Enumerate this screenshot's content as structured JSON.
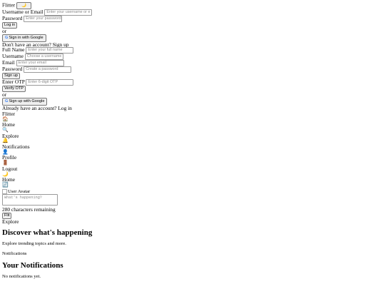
{
  "login": {
    "brand": "Flitter",
    "theme_icon": "🌙",
    "username_label": "Username or Email",
    "username_placeholder": "Enter your username or e",
    "password_label": "Password",
    "password_placeholder": "Enter your password",
    "login_button": "Log in",
    "or_text": "or",
    "google_button": "Sign in with Google",
    "signup_prompt": "Don't have an account? Sign up"
  },
  "signup": {
    "fullname_label": "Full Name",
    "fullname_placeholder": "Enter your full name",
    "username_label": "Username",
    "username_placeholder": "Choose a username",
    "email_label": "Email",
    "email_placeholder": "Enter your email",
    "password_label": "Password",
    "password_placeholder": "Create a password",
    "signup_button": "Sign up",
    "otp_label": "Enter OTP",
    "otp_placeholder": "Enter 6-digit OTP",
    "verify_button": "Verify OTP",
    "or_text": "or",
    "google_button": "Sign up with Google",
    "login_prompt": "Already have an account? Log in"
  },
  "nav": {
    "brand": "Flitter",
    "items": [
      {
        "icon": "🏠",
        "label": "Home"
      },
      {
        "icon": "🔍",
        "label": "Explore"
      },
      {
        "icon": "🔔",
        "label": "Notifications"
      },
      {
        "icon": "👤",
        "label": "Profile"
      },
      {
        "icon": "🚪",
        "label": "Logout"
      }
    ],
    "theme_icon": "🌙"
  },
  "home": {
    "title": "Home",
    "refresh_icon": "🔄",
    "avatar_alt": "User Avatar",
    "compose_placeholder": "What's happening?",
    "chars_remaining": "280 characters remaining",
    "post_button": "Flit"
  },
  "explore": {
    "label": "Explore",
    "heading": "Discover what's happening",
    "description": "Explore trending topics and more."
  },
  "notifications": {
    "label": "Notifications",
    "heading": "Your Notifications",
    "empty": "No notifications yet."
  },
  "colors": {
    "google_blue": "#4285f4",
    "button_bg": "#efefef",
    "placeholder": "#8a8a8a"
  }
}
